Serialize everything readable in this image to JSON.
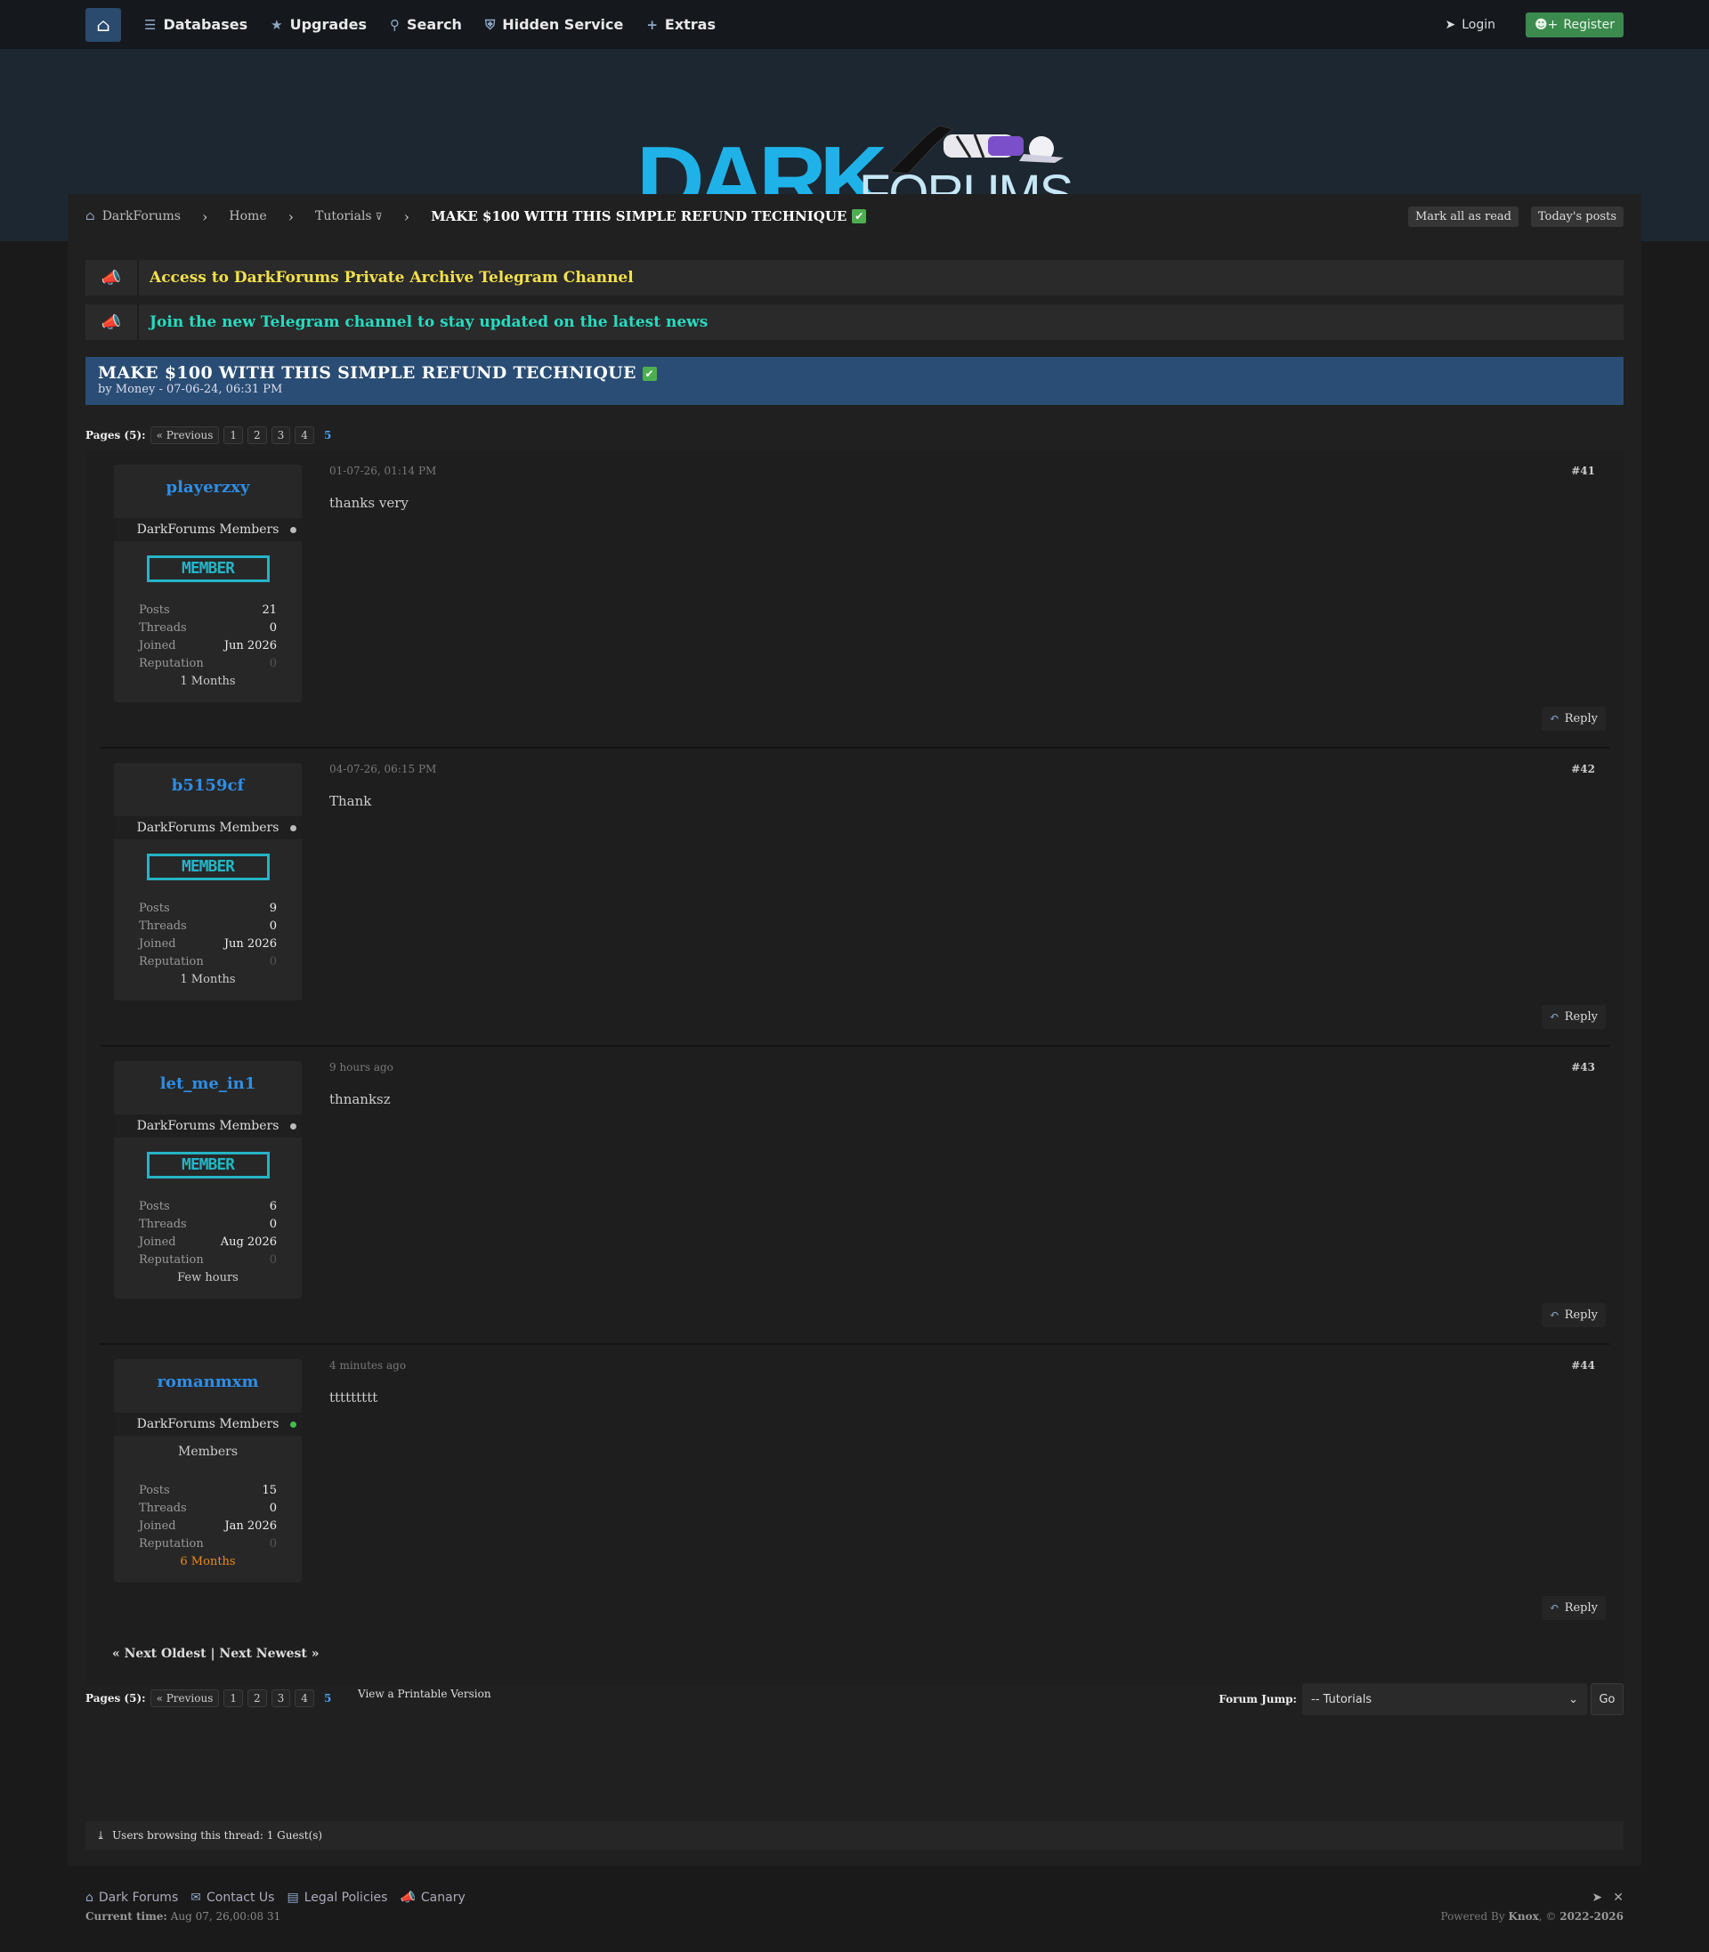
{
  "nav": {
    "items": [
      {
        "icon": "database-icon",
        "label": "Databases"
      },
      {
        "icon": "star-icon",
        "label": "Upgrades"
      },
      {
        "icon": "search-icon",
        "label": "Search"
      },
      {
        "icon": "hidden-service-icon",
        "label": "Hidden Service"
      },
      {
        "icon": "plus-icon",
        "label": "Extras"
      }
    ],
    "login": "Login",
    "register": "Register"
  },
  "logo": {
    "dark": "DARK",
    "forums": "FORUMS"
  },
  "breadcrumb": {
    "items": [
      "DarkForums",
      "Home",
      "Tutorials"
    ],
    "tutorials_arrow": "⊽",
    "current": "MAKE $100 WITH THIS SIMPLE REFUND TECHNIQUE",
    "mark_read": "Mark all as read",
    "todays_posts": "Today's posts"
  },
  "announcements": [
    {
      "text": "Access to DarkForums Private Archive Telegram Channel",
      "color": "#f2e04b"
    },
    {
      "text": "Join the new Telegram channel to stay updated on the latest news",
      "color": "#27dbc0"
    }
  ],
  "thread": {
    "title": "MAKE $100 WITH THIS SIMPLE REFUND TECHNIQUE",
    "byline": "by Money - 07-06-24, 06:31 PM"
  },
  "pagination": {
    "label": "Pages (5):",
    "previous": "« Previous",
    "pages": [
      "1",
      "2",
      "3",
      "4"
    ],
    "current": "5"
  },
  "posts": [
    {
      "username": "playerzxy",
      "group": "DarkForums Members",
      "online": false,
      "badge": "MEMBER",
      "posts": "21",
      "threads": "0",
      "joined": "Jun 2026",
      "reputation": "0",
      "age": "1 Months",
      "age_highlight": false,
      "date": "01-07-26, 01:14 PM",
      "number": "#41",
      "content": "thanks very",
      "reply": "Reply"
    },
    {
      "username": "b5159cf",
      "group": "DarkForums Members",
      "online": false,
      "badge": "MEMBER",
      "posts": "9",
      "threads": "0",
      "joined": "Jun 2026",
      "reputation": "0",
      "age": "1 Months",
      "age_highlight": false,
      "date": "04-07-26, 06:15 PM",
      "number": "#42",
      "content": "Thank",
      "reply": "Reply"
    },
    {
      "username": "let_me_in1",
      "group": "DarkForums Members",
      "online": false,
      "badge": "MEMBER",
      "posts": "6",
      "threads": "0",
      "joined": "Aug 2026",
      "reputation": "0",
      "age": "Few hours",
      "age_highlight": false,
      "date": "9 hours ago",
      "number": "#43",
      "content": "thnanksz",
      "reply": "Reply"
    },
    {
      "username": "romanmxm",
      "group": "DarkForums Members",
      "online": true,
      "badge": "",
      "group_text": "Members",
      "posts": "15",
      "threads": "0",
      "joined": "Jan 2026",
      "reputation": "0",
      "age": "6 Months",
      "age_highlight": true,
      "date": "4 minutes ago",
      "number": "#44",
      "content": "ttttttttt",
      "reply": "Reply"
    }
  ],
  "stat_labels": {
    "posts": "Posts",
    "threads": "Threads",
    "joined": "Joined",
    "reputation": "Reputation"
  },
  "next_links": "« Next Oldest | Next Newest »",
  "printable": "View a Printable Version",
  "forum_jump": {
    "label": "Forum Jump:",
    "selected": "-- Tutorials",
    "go": "Go"
  },
  "browsing": "Users browsing this thread: 1 Guest(s)",
  "footer": {
    "links": [
      {
        "icon": "home-icon",
        "label": "Dark Forums"
      },
      {
        "icon": "mail-icon",
        "label": "Contact Us"
      },
      {
        "icon": "briefcase-icon",
        "label": "Legal Policies"
      },
      {
        "icon": "megaphone-icon",
        "label": "Canary"
      }
    ],
    "time_label": "Current time:",
    "time_value": "Aug 07, 26,00:08 31",
    "powered_prefix": "Powered By",
    "powered_name": "Knox",
    "powered_suffix": ", ©",
    "copyright": "2022-2026"
  }
}
